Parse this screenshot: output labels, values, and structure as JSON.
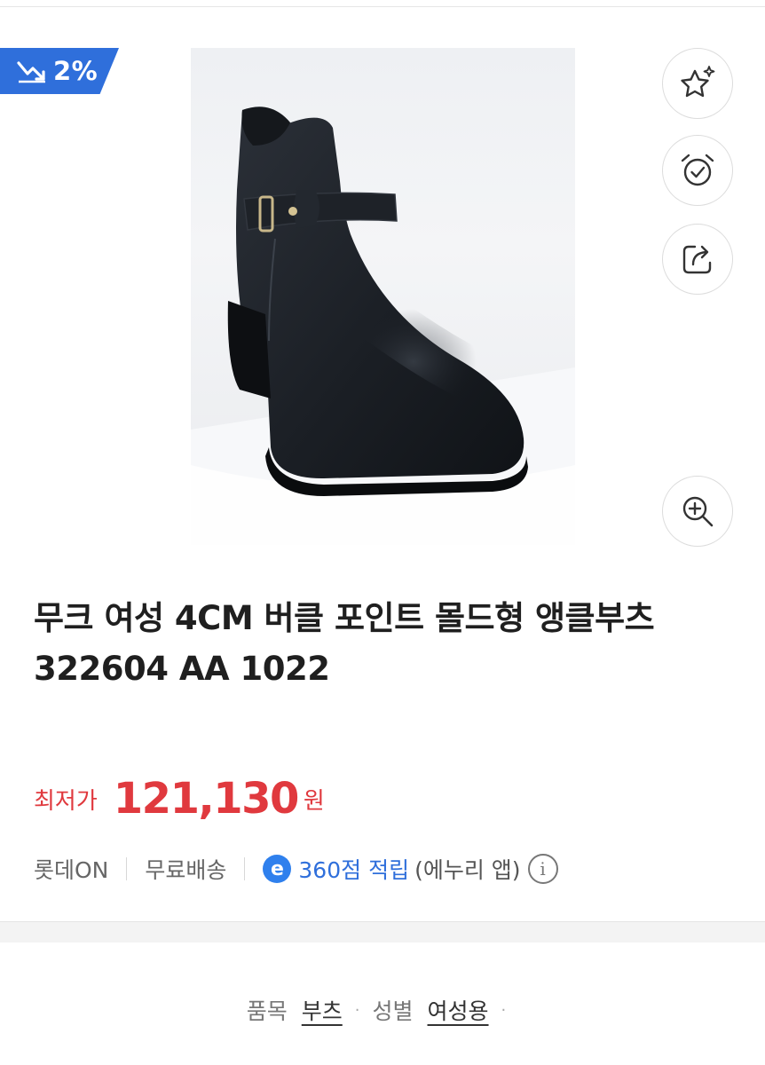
{
  "badge": {
    "discount": "2%",
    "icon": "price-down-chart-icon",
    "color": "#2f6fdb"
  },
  "side_actions": [
    {
      "name": "favorite",
      "icon": "star-sparkle-icon"
    },
    {
      "name": "price-alarm",
      "icon": "alarm-clock-check-icon"
    },
    {
      "name": "share",
      "icon": "share-arrow-icon"
    },
    {
      "name": "zoom",
      "icon": "zoom-in-icon"
    }
  ],
  "product": {
    "title_line1": "무크 여성 4CM 버클 포인트 몰드형 앵클부츠",
    "title_line2": "322604 AA 1022",
    "image": "black-ankle-boot-photo"
  },
  "price": {
    "label": "최저가",
    "value": "121,130",
    "unit": "원",
    "color": "#e0393e"
  },
  "meta": {
    "seller": "롯데ON",
    "shipping": "무료배송",
    "points_badge": "e",
    "points": "360점 적립",
    "points_note": "(에누리 앱)",
    "info_glyph": "i"
  },
  "specs": {
    "category_label": "품목",
    "category_value": "부츠",
    "gender_label": "성별",
    "gender_value": "여성용",
    "dot": "·"
  }
}
